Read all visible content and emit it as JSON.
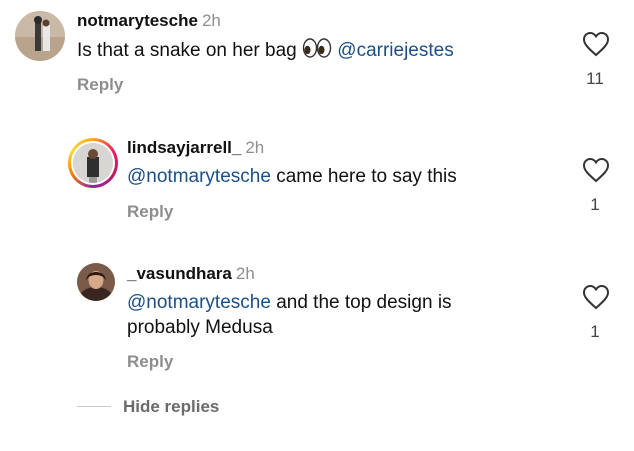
{
  "comments": [
    {
      "username": "notmarytesche",
      "time": "2h",
      "text_before": "Is that a snake on her bag",
      "emoji_icon": "eyes-emoji",
      "mention": "@carriejestes",
      "reply_label": "Reply",
      "likes": "11"
    },
    {
      "username": "lindsayjarrell_",
      "time": "2h",
      "mention": "@notmarytesche",
      "text_after": "came here to say this",
      "reply_label": "Reply",
      "likes": "1"
    },
    {
      "username": "_vasundhara",
      "time": "2h",
      "mention": "@notmarytesche",
      "text_line1": "and the top design is",
      "text_line2": "probably Medusa",
      "reply_label": "Reply",
      "likes": "1"
    }
  ],
  "hide_replies_label": "Hide replies",
  "icons": {
    "like": "heart-outline-icon",
    "story_ring": "story-ring"
  },
  "colors": {
    "mention": "#1c4f86",
    "secondary_text": "#8e8e8e"
  }
}
